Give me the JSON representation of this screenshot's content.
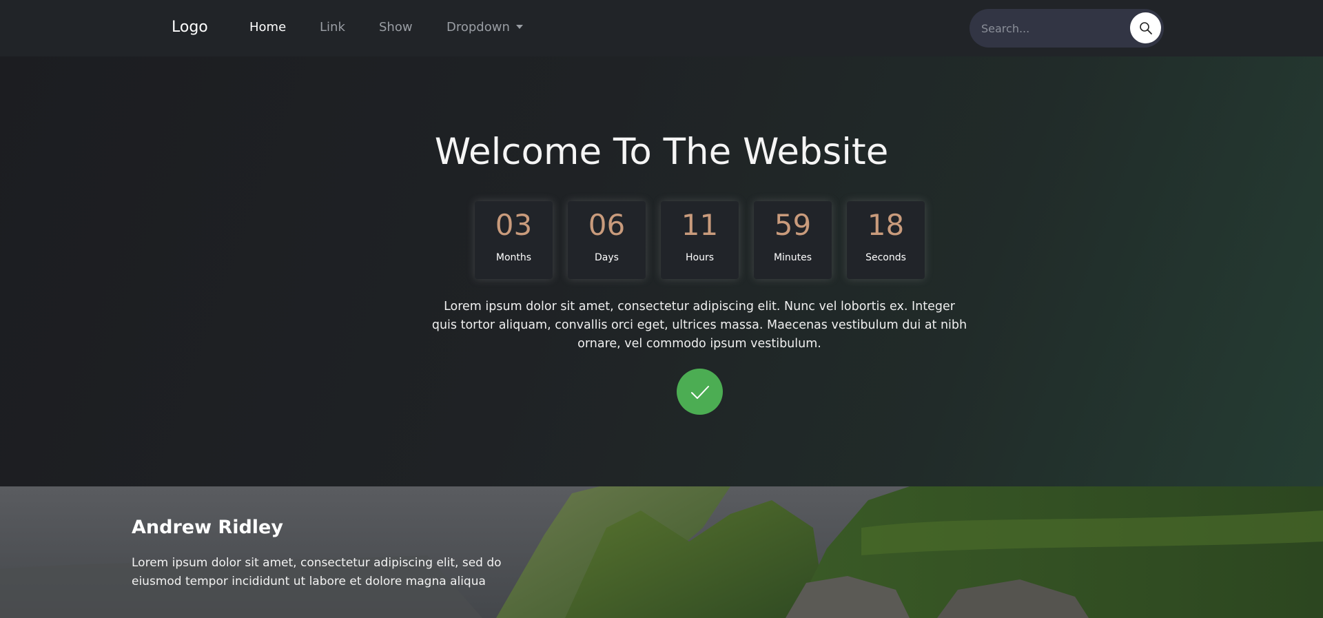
{
  "navbar": {
    "logo": "Logo",
    "links": [
      {
        "label": "Home"
      },
      {
        "label": "Link"
      },
      {
        "label": "Show"
      },
      {
        "label": "Dropdown"
      }
    ],
    "search": {
      "placeholder": "Search..."
    }
  },
  "hero": {
    "title": "Welcome To The Website",
    "countdown": [
      {
        "value": "03",
        "label": "Months"
      },
      {
        "value": "06",
        "label": "Days"
      },
      {
        "value": "11",
        "label": "Hours"
      },
      {
        "value": "59",
        "label": "Minutes"
      },
      {
        "value": "18",
        "label": "Seconds"
      }
    ],
    "text": "Lorem ipsum dolor sit amet, consectetur adipiscing elit. Nunc vel lobortis ex. Integer quis tortor aliquam, convallis orci eget, ultrices massa. Maecenas vestibulum dui at nibh ornare, vel commodo ipsum vestibulum."
  },
  "profile": {
    "name": "Andrew Ridley",
    "text": "Lorem ipsum dolor sit amet, consectetur adipiscing elit, sed do eiusmod tempor incididunt ut labore et dolore magna aliqua"
  },
  "colors": {
    "accent_number": "#c99b7c",
    "check_button": "#4cad53",
    "navbar_bg": "#212428"
  },
  "icons": [
    "search-icon",
    "check-icon",
    "chevron-down-icon"
  ]
}
